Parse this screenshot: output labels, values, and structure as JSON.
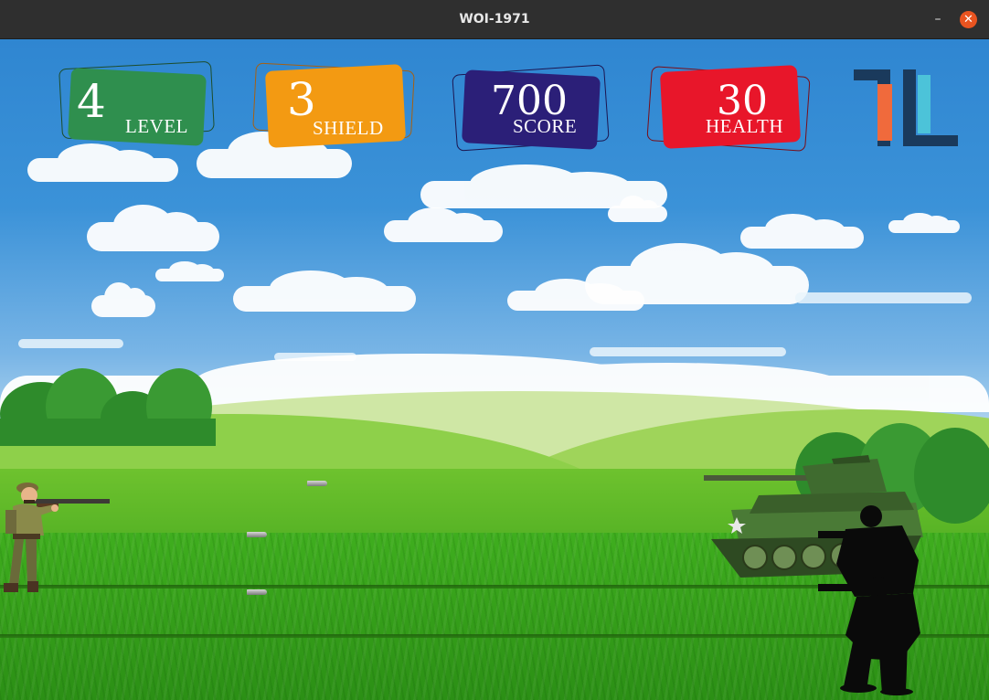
{
  "window": {
    "title": "WOI-1971",
    "minimize_glyph": "–",
    "close_glyph": "✕"
  },
  "hud": {
    "level": {
      "value": "4",
      "label": "LEVEL",
      "color": "#2f8f4e"
    },
    "shield": {
      "value": "3",
      "label": "SHIELD",
      "color": "#f39a12"
    },
    "score": {
      "value": "700",
      "label": "SCORE",
      "color": "#2b1f78"
    },
    "health": {
      "value": "30",
      "label": "HEALTH",
      "color": "#e8162a"
    }
  },
  "logo": {
    "icon": "game-logo-icon",
    "colors": [
      "#1a3a5c",
      "#f06a3c",
      "#4cc3d9"
    ]
  },
  "entities": {
    "player": {
      "icon": "rifleman-soldier"
    },
    "bullets": [
      {
        "icon": "bullet-icon"
      },
      {
        "icon": "bullet-icon"
      },
      {
        "icon": "bullet-icon"
      }
    ],
    "enemy_tank": {
      "icon": "tank-icon",
      "color": "#3f6b2f"
    },
    "enemy_soldiers": [
      {
        "icon": "enemy-soldier-silhouette"
      },
      {
        "icon": "enemy-soldier-silhouette"
      }
    ]
  },
  "colors": {
    "sky": "#3b92d8",
    "grass": "#3fae1e",
    "titlebar": "#2f2f2f",
    "close_button": "#e95420"
  }
}
